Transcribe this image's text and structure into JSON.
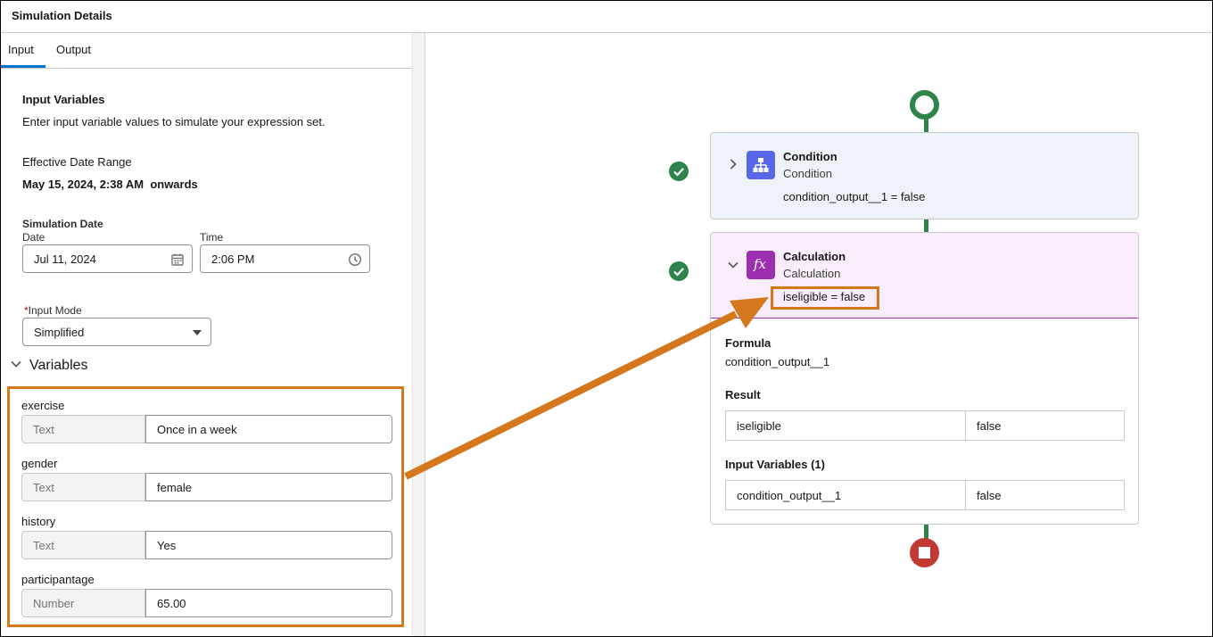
{
  "header": {
    "title": "Simulation Details"
  },
  "tabs": [
    {
      "label": "Input"
    },
    {
      "label": "Output"
    }
  ],
  "input_panel": {
    "heading": "Input Variables",
    "description": "Enter input variable values to simulate your expression set.",
    "effective_label": "Effective Date Range",
    "effective_value": "May 15, 2024, 2:38 AM  onwards",
    "sim_date_heading": "Simulation Date",
    "date_label": "Date",
    "date_value": "Jul 11, 2024",
    "time_label": "Time",
    "time_value": "2:06 PM",
    "mode_required": "*",
    "mode_label": "Input Mode",
    "mode_value": "Simplified",
    "variables_title": "Variables",
    "variables": [
      {
        "name": "exercise",
        "type": "Text",
        "value": "Once in a week"
      },
      {
        "name": "gender",
        "type": "Text",
        "value": "female"
      },
      {
        "name": "history",
        "type": "Text",
        "value": "Yes"
      },
      {
        "name": "participantage",
        "type": "Number",
        "value": "65.00"
      }
    ]
  },
  "canvas": {
    "condition": {
      "title": "Condition",
      "subtitle": "Condition",
      "output": "condition_output__1 = false"
    },
    "calculation": {
      "title": "Calculation",
      "subtitle": "Calculation",
      "output": "iseligible = false",
      "formula_label": "Formula",
      "formula_value": "condition_output__1",
      "result_label": "Result",
      "result_name": "iseligible",
      "result_value": "false",
      "inputs_label": "Input Variables (1)",
      "input_name": "condition_output__1",
      "input_value": "false"
    }
  },
  "colors": {
    "accent": "#0176d3",
    "highlight": "#d4771d",
    "success": "#2e844a",
    "stop": "#c23934",
    "condition_icon": "#5867e8",
    "calc_icon": "#9c2fb0"
  }
}
